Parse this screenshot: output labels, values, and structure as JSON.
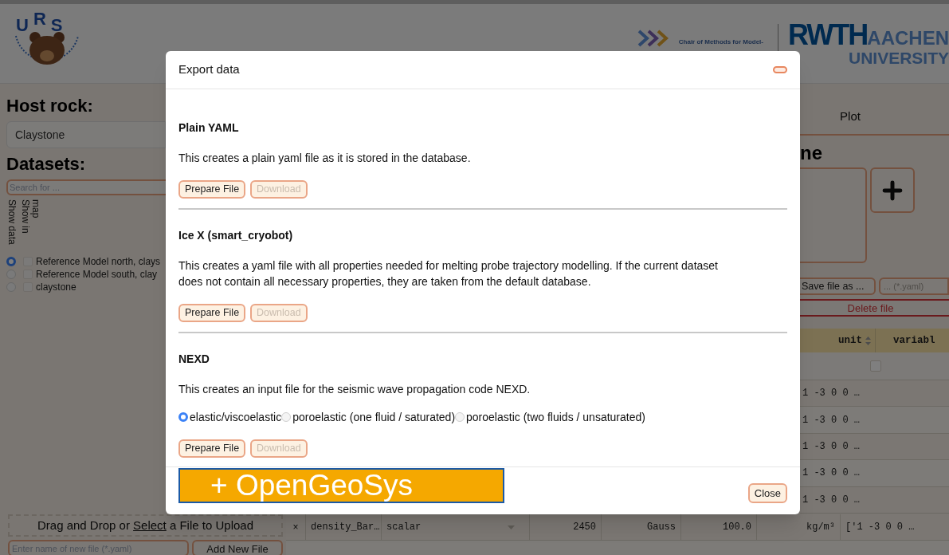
{
  "header": {
    "logo_letters": [
      "U",
      "R",
      "S"
    ],
    "chair_text": "Chair of Methods for Model-",
    "university": {
      "short": "RWTH",
      "city": "AACHEN",
      "name": "UNIVERSITY"
    }
  },
  "sidebar": {
    "host_rock_label": "Host rock:",
    "host_rock_value": "Claystone",
    "datasets_label": "Datasets:",
    "search": {
      "placeholder": "Search for ..."
    },
    "columns": [
      "Show data",
      "Show in map"
    ],
    "datasets": [
      {
        "name": "Reference Model north, clays",
        "selected": true,
        "checked": false
      },
      {
        "name": "Reference Model south, clay",
        "selected": false,
        "checked": false
      },
      {
        "name": "claystone",
        "selected": false,
        "checked": false
      }
    ],
    "upload": {
      "before": "Drag and Drop or ",
      "link": "Select",
      "after": " a File to Upload"
    },
    "new_file": {
      "placeholder": "Enter name of new file (*.yaml)",
      "button": "Add New File"
    }
  },
  "editor": {
    "tab": "Plot",
    "title": "ne",
    "save_button": "Save file as ...",
    "save_name": {
      "placeholder": "... (*.yaml)"
    },
    "delete_button": "Delete file"
  },
  "table": {
    "columns": [
      "unit",
      "variabl"
    ],
    "filter": {
      "checked": false
    },
    "covered_rows": [
      {
        "variable": "1 -3 0 0 …"
      },
      {
        "variable": "1 -3 0 0 …"
      },
      {
        "variable": "1 -3 0 0 …"
      },
      {
        "variable": "1 -3 0 0 …"
      },
      {
        "variable": "1 -3 0 0 …"
      }
    ],
    "rows": [
      {
        "delete": "×",
        "name": "density_Bar…",
        "type": "scalar",
        "value": "2450",
        "distribution": "Gauss",
        "uncertainty": "100.0",
        "unit": "kg/m³",
        "variable": "['1 -3 0 0 …"
      }
    ]
  },
  "dialog": {
    "title": "Export data",
    "sections": [
      {
        "title": "Plain YAML",
        "description": "This creates a plain yaml file as it is stored in the database.",
        "buttons": [
          {
            "label": "Prepare File",
            "disabled": false
          },
          {
            "label": "Download",
            "disabled": true
          }
        ]
      },
      {
        "title": "Ice X (smart_cryobot)",
        "description": "This creates a yaml file with all properties needed for melting probe trajectory modelling. If the current dataset does not contain all necessary properties, they are taken from the default database.",
        "buttons": [
          {
            "label": "Prepare File",
            "disabled": false
          },
          {
            "label": "Download",
            "disabled": true
          }
        ]
      },
      {
        "title": "NEXD",
        "description": "This creates an input file for the seismic wave propagation code NEXD.",
        "options": [
          {
            "label": "elastic/viscoelastic",
            "selected": true
          },
          {
            "label": "poroelastic (one fluid / saturated)",
            "selected": false
          },
          {
            "label": "poroelastic (two fluids / unsaturated)",
            "selected": false
          }
        ],
        "buttons": [
          {
            "label": "Prepare File",
            "disabled": false
          },
          {
            "label": "Download",
            "disabled": true
          }
        ]
      }
    ],
    "banner": "+ OpenGeoSys",
    "close_button": "Close"
  }
}
